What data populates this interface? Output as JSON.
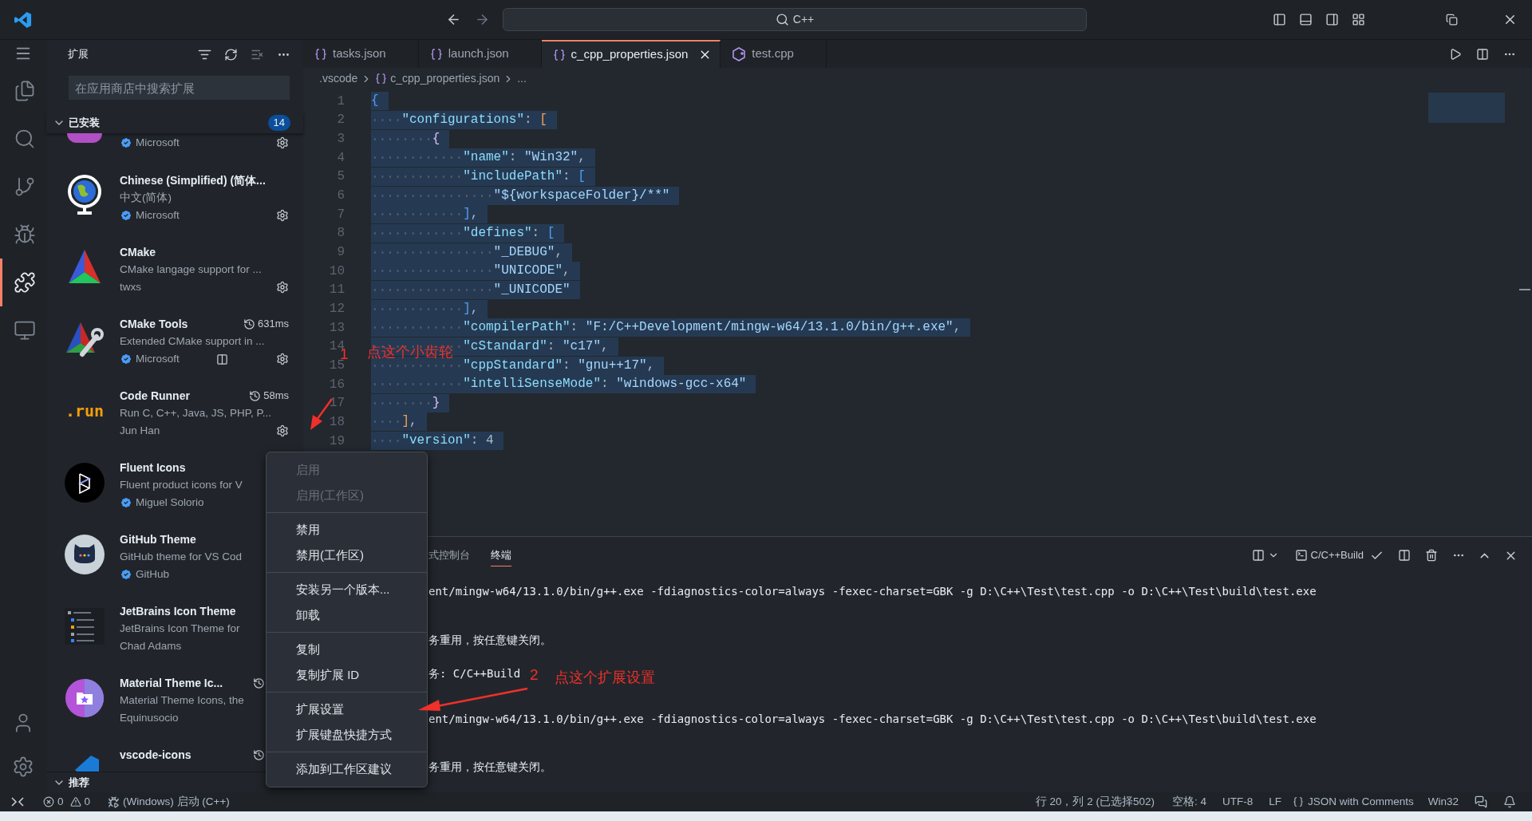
{
  "title_bar": {
    "search": "C++"
  },
  "activity_bar": {
    "items": [
      {
        "kind": "files",
        "selected": false
      },
      {
        "kind": "search",
        "selected": false
      },
      {
        "kind": "source-control",
        "selected": false
      },
      {
        "kind": "debug",
        "selected": false
      },
      {
        "kind": "extensions",
        "selected": true
      },
      {
        "kind": "remote",
        "selected": false
      }
    ]
  },
  "sidebar": {
    "title": "扩展",
    "search": {
      "placeholder": "在应用商店中搜索扩展"
    },
    "installed": {
      "label": "已安装",
      "count": "14",
      "expanded": true
    },
    "extensions": [
      {
        "kind": "partial",
        "publisher": "Microsoft",
        "verified": true,
        "gear": true
      },
      {
        "kind": "full",
        "name": "Chinese (Simplified) (简体...",
        "description": "中文(简体)",
        "publisher": "Microsoft",
        "verified": true,
        "clock": false,
        "gear": true
      },
      {
        "kind": "full",
        "name": "CMake",
        "description": "CMake langage support for ...",
        "publisher": "twxs",
        "verified": false,
        "clock": false,
        "gear": true
      },
      {
        "kind": "full",
        "name": "CMake Tools",
        "clock": true,
        "timing": "631ms",
        "description": "Extended CMake support in ...",
        "publisher": "Microsoft",
        "verified": true,
        "status_icon": true,
        "gear": true
      },
      {
        "kind": "full",
        "logo_text": ".run",
        "name": "Code Runner",
        "clock": true,
        "timing": "58ms",
        "description": "Run C, C++, Java, JS, PHP, P...",
        "publisher": "Jun Han",
        "verified": false,
        "gear": true
      },
      {
        "kind": "full",
        "name": "Fluent Icons",
        "description": "Fluent product icons for V",
        "publisher": "Miguel Solorio",
        "verified": true,
        "clock": false,
        "gear": false
      },
      {
        "kind": "full",
        "name": "GitHub Theme",
        "description": "GitHub theme for VS Cod",
        "publisher": "GitHub",
        "verified": true,
        "clock": false,
        "gear": false
      },
      {
        "kind": "full",
        "name": "JetBrains Icon Theme",
        "description": "JetBrains Icon Theme for",
        "publisher": "Chad Adams",
        "verified": false,
        "clock": false,
        "gear": false
      },
      {
        "kind": "full",
        "name": "Material Theme Ic...",
        "clock": true,
        "description": "Material Theme Icons, the",
        "publisher": "Equinusocio",
        "verified": false,
        "gear": false
      },
      {
        "kind": "full",
        "name": "vscode-icons",
        "clock": true,
        "gear": false
      }
    ],
    "recommended": {
      "label": "推荐",
      "expanded": true
    }
  },
  "editor": {
    "tabs": [
      {
        "label": "tasks.json",
        "kind": "json",
        "selected": false
      },
      {
        "label": "launch.json",
        "kind": "json",
        "selected": false
      },
      {
        "label": "c_cpp_properties.json",
        "kind": "json",
        "selected": true
      },
      {
        "label": "test.cpp",
        "kind": "cpp",
        "selected": false
      }
    ],
    "breadcrumb": [
      {
        "label": ".vscode",
        "kind": "folder"
      },
      {
        "label": "c_cpp_properties.json",
        "kind": "json"
      },
      {
        "label": "...",
        "kind": "more"
      }
    ],
    "lines": [
      {
        "number": "1",
        "text": "{"
      },
      {
        "number": "2",
        "text": "    \"configurations\": ["
      },
      {
        "number": "3",
        "text": "        {"
      },
      {
        "number": "4",
        "text": "            \"name\": \"Win32\","
      },
      {
        "number": "5",
        "text": "            \"includePath\": ["
      },
      {
        "number": "6",
        "text": "                \"${workspaceFolder}/**\""
      },
      {
        "number": "7",
        "text": "            ],"
      },
      {
        "number": "8",
        "text": "            \"defines\": ["
      },
      {
        "number": "9",
        "text": "                \"_DEBUG\","
      },
      {
        "number": "10",
        "text": "                \"UNICODE\","
      },
      {
        "number": "11",
        "text": "                \"_UNICODE\""
      },
      {
        "number": "12",
        "text": "            ],"
      },
      {
        "number": "13",
        "text": "            \"compilerPath\": \"F:/C++Development/mingw-w64/13.1.0/bin/g++.exe\","
      },
      {
        "number": "14",
        "text": "            \"cStandard\": \"c17\","
      },
      {
        "number": "15",
        "text": "            \"cppStandard\": \"gnu++17\","
      },
      {
        "number": "16",
        "text": "            \"intelliSenseMode\": \"windows-gcc-x64\""
      },
      {
        "number": "17",
        "text": "        }"
      },
      {
        "number": "18",
        "text": "    ],"
      },
      {
        "number": "19",
        "text": "    \"version\": 4"
      }
    ]
  },
  "panel": {
    "tabs": [
      {
        "label": "式控制台",
        "selected": false
      },
      {
        "label": "终端",
        "selected": true
      }
    ],
    "terminal": "C/C++Build",
    "lines": [
      "ent/mingw-w64/13.1.0/bin/g++.exe -fdiagnostics-color=always -fexec-charset=GBK -g D:\\C++\\Test\\test.cpp -o D:\\C++\\Test\\build\\test.exe",
      "务重用，按任意键关闭。",
      "务: C/C++Build",
      "ent/mingw-w64/13.1.0/bin/g++.exe -fdiagnostics-color=always -fexec-charset=GBK -g D:\\C++\\Test\\test.cpp -o D:\\C++\\Test\\build\\test.exe",
      "务重用，按任意键关闭。"
    ]
  },
  "context_menu": {
    "groups": [
      {
        "items": [
          {
            "label": "启用",
            "disabled": true
          },
          {
            "label": "启用(工作区)",
            "disabled": true
          }
        ]
      },
      {
        "items": [
          {
            "label": "禁用",
            "disabled": false
          },
          {
            "label": "禁用(工作区)",
            "disabled": false
          }
        ]
      },
      {
        "items": [
          {
            "label": "安装另一个版本...",
            "disabled": false
          },
          {
            "label": "卸载",
            "disabled": false
          }
        ]
      },
      {
        "items": [
          {
            "label": "复制",
            "disabled": false
          },
          {
            "label": "复制扩展 ID",
            "disabled": false
          }
        ]
      },
      {
        "items": [
          {
            "label": "扩展设置",
            "disabled": false
          },
          {
            "label": "扩展键盘快捷方式",
            "disabled": false
          }
        ]
      },
      {
        "items": [
          {
            "label": "添加到工作区建议",
            "disabled": false
          }
        ]
      }
    ]
  },
  "annotations": [
    {
      "number": "1",
      "text": "点这个小齿轮"
    },
    {
      "number": "2",
      "text": "点这个扩展设置"
    }
  ],
  "status_bar": {
    "errors": "0",
    "warnings": "0",
    "launch": "(Windows) 启动 (C++)",
    "position": "行 20，列 2 (已选择502)",
    "indent": "空格: 4",
    "encoding": "UTF-8",
    "eol": "LF",
    "language": "JSON with Comments",
    "config": "Win32"
  }
}
